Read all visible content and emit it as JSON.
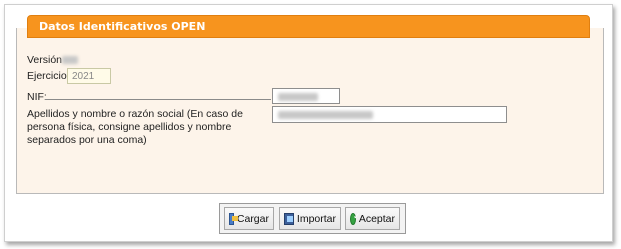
{
  "panel": {
    "title": "Datos Identificativos OPEN"
  },
  "form": {
    "version_label": "Versión",
    "ejercicio_label": "Ejercicio",
    "ejercicio_value": "2021",
    "nif_label": "NIF:",
    "nombre_label": "Apellidos y nombre o razón social (En caso de persona física, consigne apellidos y nombre separados por una coma)"
  },
  "buttons": {
    "cargar": "Cargar",
    "importar": "Importar",
    "aceptar": "Aceptar"
  },
  "icons": {
    "cargar": "load-icon",
    "importar": "import-icon",
    "aceptar": "check-icon"
  }
}
